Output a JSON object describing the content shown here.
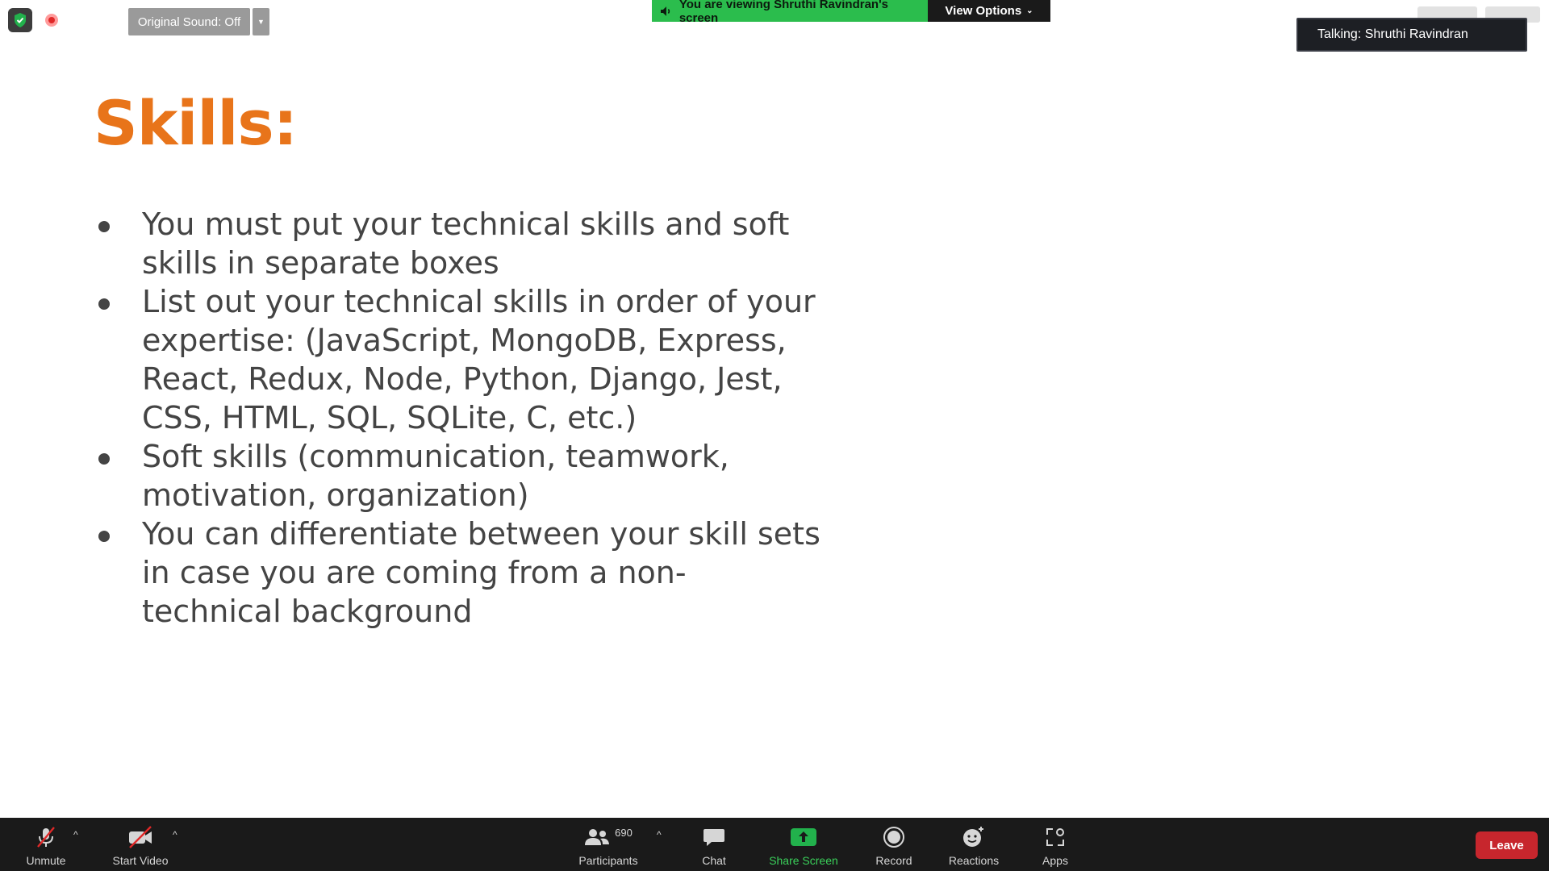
{
  "top": {
    "original_sound_label": "Original Sound: Off",
    "banner_text": "You are viewing Shruthi Ravindran's screen",
    "view_options_label": "View Options",
    "talking_label": "Talking: Shruthi Ravindran"
  },
  "slide": {
    "title": "Skills:",
    "bullets": [
      "You must put your technical skills and soft skills in separate boxes",
      "List out your technical skills in order of your expertise: (JavaScript, MongoDB, Express, React, Redux, Node, Python, Django, Jest, CSS, HTML, SQL, SQLite, C, etc.)",
      "Soft skills (communication, teamwork, motivation, organization)",
      "You can differentiate between your skill sets in case you are coming from a non-technical background"
    ]
  },
  "toolbar": {
    "unmute": "Unmute",
    "start_video": "Start Video",
    "participants_count": "690",
    "participants": "Participants",
    "chat": "Chat",
    "share_screen": "Share Screen",
    "record": "Record",
    "reactions": "Reactions",
    "apps": "Apps",
    "leave": "Leave"
  },
  "colors": {
    "title_orange": "#e8741a",
    "banner_green": "#2bbd4d",
    "share_green": "#3ad05a",
    "leave_red": "#c7262d"
  }
}
